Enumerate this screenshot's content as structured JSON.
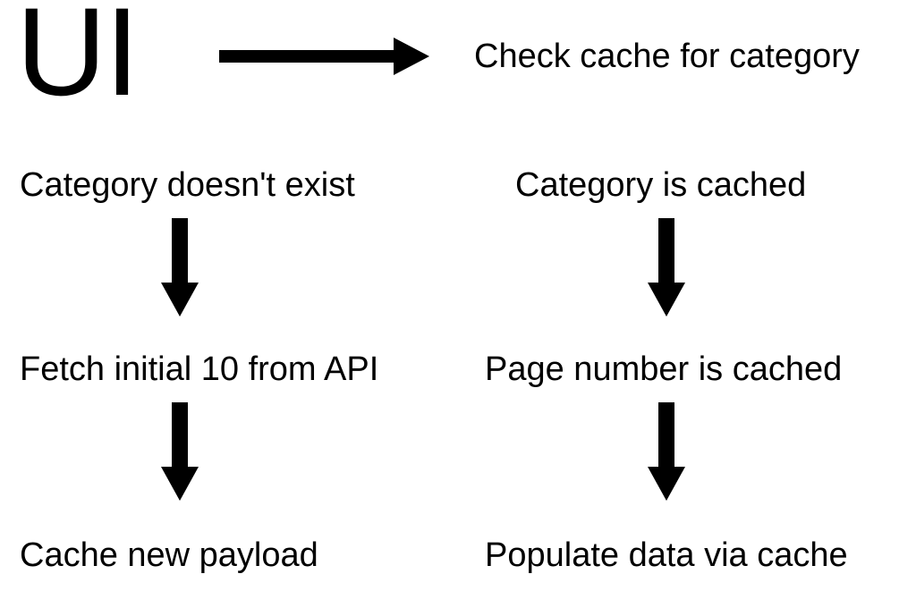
{
  "nodes": {
    "ui": "UI",
    "check_cache": "Check cache for category",
    "cat_not_exist": "Category doesn't exist",
    "cat_cached": "Category is cached",
    "fetch_initial": "Fetch initial 10 from API",
    "page_cached": "Page number is cached",
    "cache_payload": "Cache new payload",
    "populate": "Populate data via cache"
  }
}
